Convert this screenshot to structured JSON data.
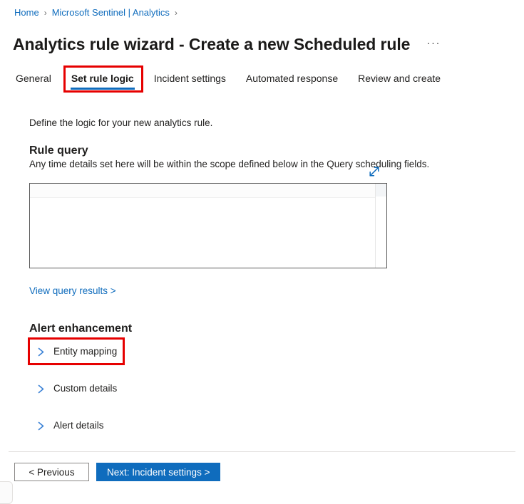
{
  "breadcrumb": {
    "items": [
      {
        "label": "Home"
      },
      {
        "label": "Microsoft Sentinel | Analytics"
      }
    ],
    "separator": "›"
  },
  "header": {
    "title": "Analytics rule wizard - Create a new Scheduled rule",
    "more_label": "···"
  },
  "tabs": [
    {
      "label": "General",
      "active": false
    },
    {
      "label": "Set rule logic",
      "active": true
    },
    {
      "label": "Incident settings",
      "active": false
    },
    {
      "label": "Automated response",
      "active": false
    },
    {
      "label": "Review and create",
      "active": false
    }
  ],
  "main": {
    "intro": "Define the logic for your new analytics rule.",
    "rule_query": {
      "heading": "Rule query",
      "description": "Any time details set here will be within the scope defined below in the Query scheduling fields.",
      "expand_icon": "expand-diagonal-icon",
      "editor_value": "",
      "view_results_link": "View query results >"
    },
    "alert_enhancement": {
      "heading": "Alert enhancement",
      "sections": [
        {
          "label": "Entity mapping",
          "icon": "chevron-right-icon",
          "expanded": false,
          "highlighted": true
        },
        {
          "label": "Custom details",
          "icon": "chevron-right-icon",
          "expanded": false,
          "highlighted": false
        },
        {
          "label": "Alert details",
          "icon": "chevron-right-icon",
          "expanded": false,
          "highlighted": false
        }
      ]
    }
  },
  "footer": {
    "previous_label": "< Previous",
    "next_label": "Next: Incident settings >"
  },
  "colors": {
    "link_blue": "#0f6cbd",
    "primary_blue": "#0f6cbd",
    "annotation_red": "#e60000",
    "text_dark": "#201f1e",
    "border_gray": "#8a8886"
  }
}
